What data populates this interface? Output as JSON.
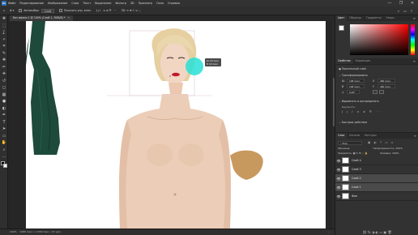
{
  "app": {
    "logo": "Ps"
  },
  "menu": [
    "Файл",
    "Редактирование",
    "Изображение",
    "Слои",
    "Текст",
    "Выделение",
    "Фильтр",
    "3D",
    "Просмотр",
    "Окно",
    "Справка"
  ],
  "window_controls": [
    "—",
    "❐",
    "✕"
  ],
  "options": {
    "autoselect_label": "Автовыбор:",
    "autoselect_value": "Слой",
    "transform_label": "Показать упр. элем."
  },
  "document_tab": {
    "title": "Без имени-1 @ 100% (Слой 1, RGB/8) *",
    "close": "✕"
  },
  "tools": [
    "move-icon",
    "marquee-icon",
    "lasso-icon",
    "wand-icon",
    "crop-icon",
    "eyedropper-icon",
    "heal-icon",
    "brush-icon",
    "stamp-icon",
    "history-brush-icon",
    "eraser-icon",
    "gradient-icon",
    "blur-icon",
    "dodge-icon",
    "pen-icon",
    "type-icon",
    "path-select-icon",
    "shape-icon",
    "hand-icon",
    "zoom-icon",
    "more-icon"
  ],
  "tool_glyphs": [
    "✥",
    "⬚",
    "ʆ",
    "✧",
    "⌗",
    "✎",
    "✚",
    "✏",
    "⎈",
    "↺",
    "◻",
    "▦",
    "●",
    "◐",
    "✒",
    "T",
    "➤",
    "▭",
    "✋",
    "⌕",
    "…"
  ],
  "status": {
    "zoom": "100%",
    "info": "1080 пикс. x 1350 пикс. (72 ppi)"
  },
  "canvas_tooltip": {
    "line1": "Ш: 94 пикс.",
    "line2": "В: 94 пикс."
  },
  "color_panel": {
    "tabs": [
      "Цвет",
      "Образцы",
      "Градиенты",
      "Узоры"
    ]
  },
  "properties_panel": {
    "tabs": [
      "Свойства",
      "Коррекция"
    ],
    "layer_type": "Пиксельный слой",
    "transform_label": "Трансформировать",
    "w_value": "108 пикс.",
    "x_value": "480 пикс.",
    "h_value": "108 пикс.",
    "y_value": "460 пикс.",
    "angle_value": "0,00°",
    "align_label": "Выровнять и распределить",
    "align_sub": "Выровнять:",
    "quick_label": "Быстрые действия"
  },
  "layers_panel": {
    "tabs": [
      "Слои",
      "Каналы",
      "Контуры"
    ],
    "search": "Вид",
    "filter_icons": "▣ ◐ T ▭ ⌂",
    "blend_mode": "Обычные",
    "opacity_label": "Непрозрачность:",
    "opacity_value": "100%",
    "lock_label": "Закрепить:",
    "fill_label": "Заливка:",
    "fill_value": "100%",
    "layers": [
      {
        "name": "Слой 4",
        "selected": false
      },
      {
        "name": "Слой 3",
        "selected": false
      },
      {
        "name": "Слой 2",
        "selected": true
      },
      {
        "name": "Слой 1",
        "selected": true
      },
      {
        "name": "Фон",
        "selected": false
      }
    ],
    "footer_icons": "⛓ fx ◑ ◐ ▭ ▣ 🗑"
  },
  "colors": {
    "dress": "#1d4a3a",
    "skin": "#eccdb7",
    "hair": "#e6cfa0",
    "hand_shape": "#c8995e",
    "brush_cursor": "#28e0d6"
  }
}
